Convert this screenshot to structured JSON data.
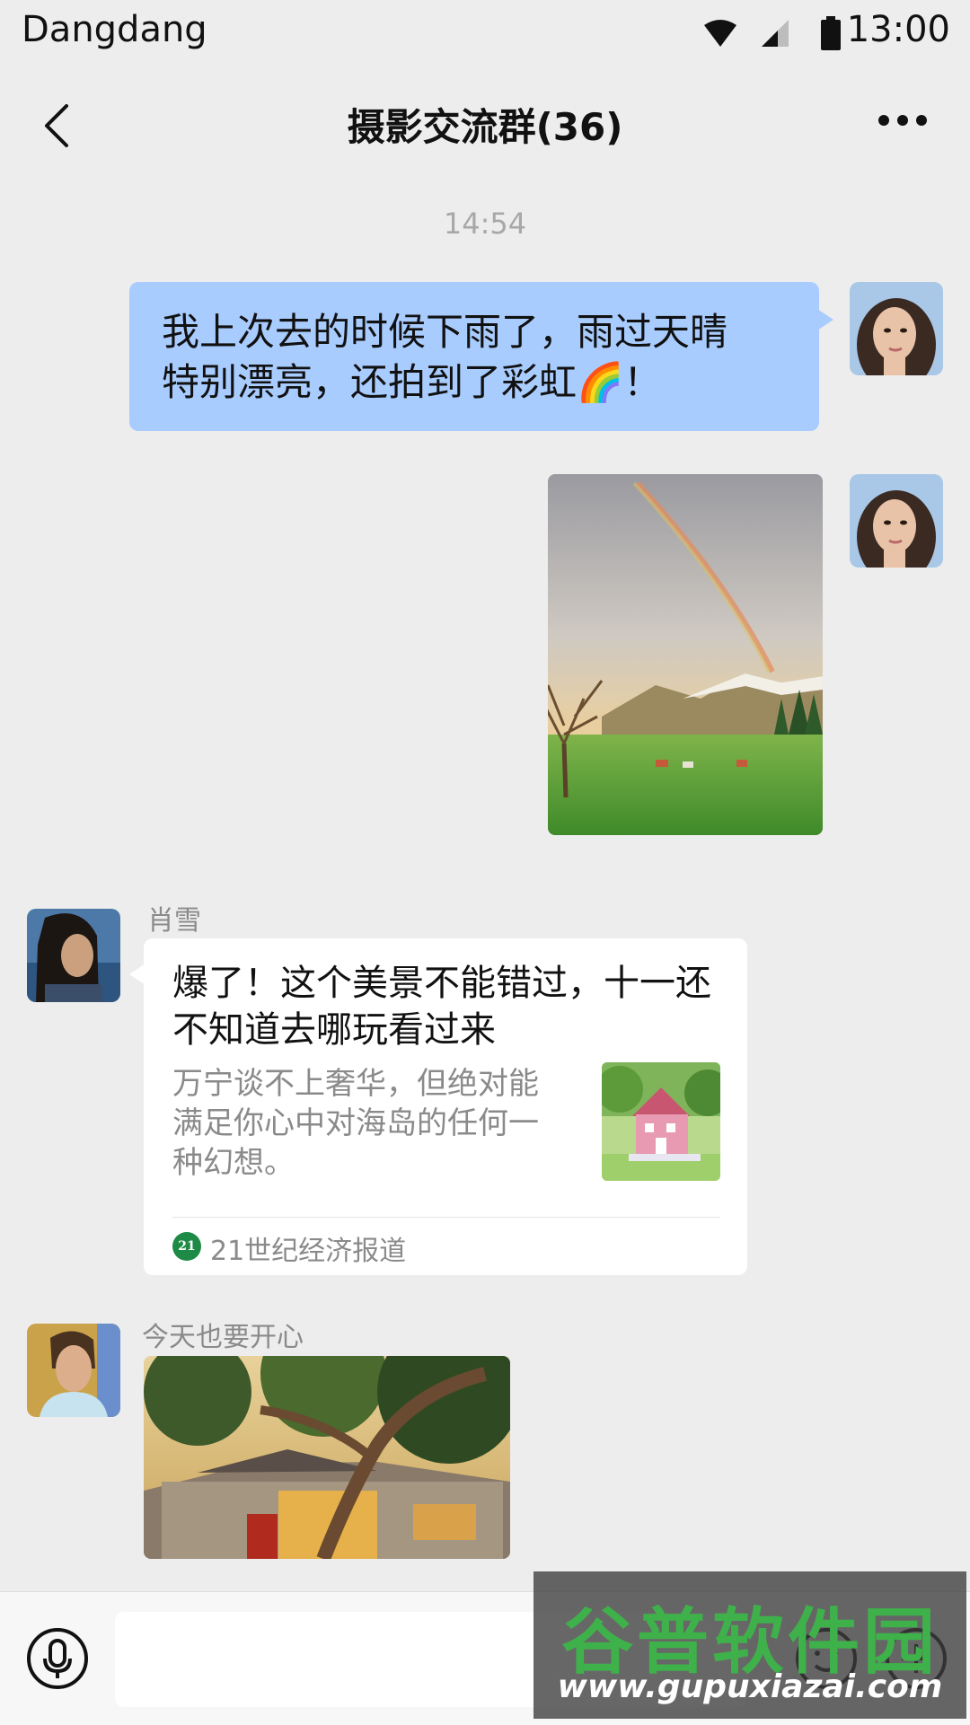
{
  "status_bar": {
    "carrier": "Dangdang",
    "time": "13:00",
    "icons": [
      "wifi-icon",
      "signal-icon",
      "battery-icon"
    ]
  },
  "nav": {
    "title": "摄影交流群(36)",
    "back_icon": "back-arrow-icon",
    "more_icon": "more-icon"
  },
  "chat": {
    "timestamp": "14:54",
    "messages": [
      {
        "from": "me",
        "type": "text",
        "text_line1": "我上次去的时候下雨了，雨过天晴",
        "text_line2": "特别漂亮，还拍到了彩虹🌈！"
      },
      {
        "from": "me",
        "type": "image",
        "description_icon": "rainbow-landscape-photo"
      },
      {
        "from": "肖雪",
        "type": "article-card",
        "title": "爆了！这个美景不能错过，十一还不知道去哪玩看过来",
        "description": "万宁谈不上奢华，但绝对能满足你心中对海岛的任何一种幻想。",
        "source_logo_text": "21",
        "source": "21世纪经济报道"
      },
      {
        "from": "今天也要开心",
        "type": "image",
        "description_icon": "courtyard-tree-photo"
      }
    ]
  },
  "input_bar": {
    "voice_icon": "microphone-icon",
    "emoji_icon": "emoji-icon",
    "plus_icon": "plus-icon",
    "placeholder": ""
  },
  "watermark": {
    "main": "谷普软件园",
    "url": "www.gupuxiazai.com"
  },
  "colors": {
    "background": "#ededed",
    "my_bubble": "#a9ccff",
    "card": "#ffffff",
    "muted_text": "#8a8a8a",
    "source_logo": "#1d8a45"
  }
}
